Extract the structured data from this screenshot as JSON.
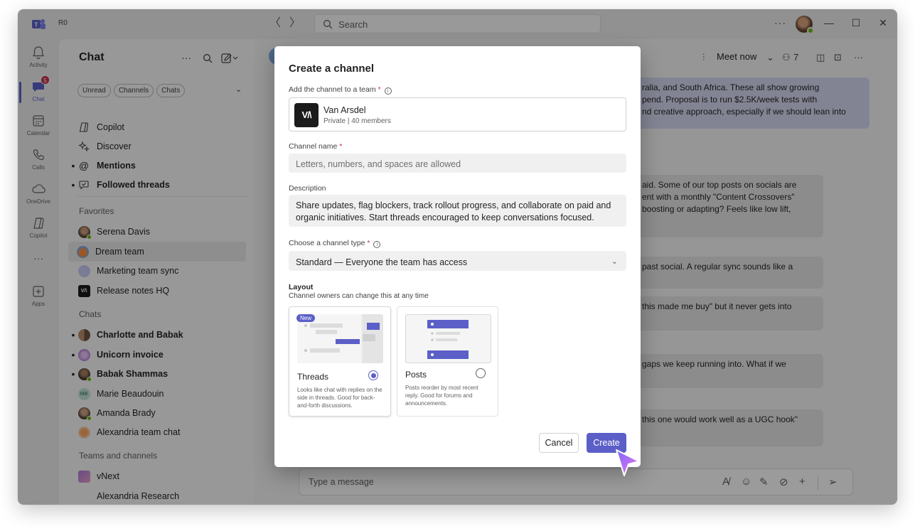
{
  "titlebar": {
    "profile_initials": "R0",
    "search_placeholder": "Search",
    "back_glyph": "〈",
    "forward_glyph": "〉",
    "more_glyph": "···",
    "minimize_glyph": "—",
    "maximize_glyph": "☐",
    "close_glyph": "✕"
  },
  "rail": {
    "items": [
      {
        "label": "Activity",
        "icon": "bell-icon"
      },
      {
        "label": "Chat",
        "icon": "chat-icon",
        "badge": "5"
      },
      {
        "label": "Calendar",
        "icon": "calendar-icon"
      },
      {
        "label": "Calls",
        "icon": "phone-icon"
      },
      {
        "label": "OneDrive",
        "icon": "cloud-icon"
      },
      {
        "label": "Copilot",
        "icon": "copilot-icon"
      },
      {
        "label": "Apps",
        "icon": "apps-icon"
      }
    ],
    "more_glyph": "···"
  },
  "chat_pane": {
    "title": "Chat",
    "filters": [
      "Unread",
      "Channels",
      "Chats"
    ],
    "top_items": [
      "Copilot",
      "Discover",
      "Mentions",
      "Followed threads"
    ],
    "favorites_header": "Favorites",
    "favorites": [
      "Serena Davis",
      "Dream team",
      "Marketing team sync",
      "Release notes HQ"
    ],
    "chats_header": "Chats",
    "chats": [
      "Charlotte and Babak",
      "Unicorn invoice",
      "Babak Shammas",
      "Marie Beaudouin",
      "Amanda Brady",
      "Alexandria team chat"
    ],
    "teams_header": "Teams and channels",
    "teams": [
      "vNext",
      "Alexandria Research"
    ],
    "avatar_initials_mb": "MB",
    "release_logo_text": "V/\\"
  },
  "main": {
    "meet_now": "Meet now",
    "participants_count": "7",
    "messages": [
      "ralia, and South Africa. These all show growing\npend. Proposal is to run $2.5K/week tests with\nnd creative approach, especially if we should lean into",
      "aid. Some of our top posts on socials are\nent with a monthly \"Content Crossovers\"\nboosting or adapting? Feels like low lift,",
      "past social. A regular sync sounds like a",
      "this made me buy\" but it never gets into",
      "gaps we keep running into. What if we",
      "this one would work well as a UGC hook\""
    ],
    "composer_placeholder": "Type a message"
  },
  "dialog": {
    "title": "Create a channel",
    "team_label": "Add the channel to a team",
    "team": {
      "name": "Van Arsdel",
      "meta": "Private | 40 members",
      "logo_text": "V/\\"
    },
    "name_label": "Channel name",
    "name_placeholder": "Letters, numbers, and spaces are allowed",
    "description_label": "Description",
    "description_value": "Share updates, flag blockers, track rollout progress, and collaborate on paid and organic initiatives. Start threads encouraged to keep conversations focused.",
    "type_label": "Choose a channel type",
    "type_value": "Standard — Everyone the team has access",
    "required_mark": "*",
    "info_glyph": "i",
    "layout_title": "Layout",
    "layout_subtitle": "Channel owners can change this at any time",
    "layouts": [
      {
        "name": "Threads",
        "badge": "New",
        "description": "Looks like chat with replies on the side in threads. Good for back-and-forth discussions.",
        "selected": true
      },
      {
        "name": "Posts",
        "description": "Posts reorder by most recent reply. Good for forums and announcements.",
        "selected": false
      }
    ],
    "cancel_label": "Cancel",
    "create_label": "Create"
  },
  "colors": {
    "accent": "#5b5fc7",
    "badge_red": "#c4314b",
    "presence_green": "#6bb700"
  }
}
